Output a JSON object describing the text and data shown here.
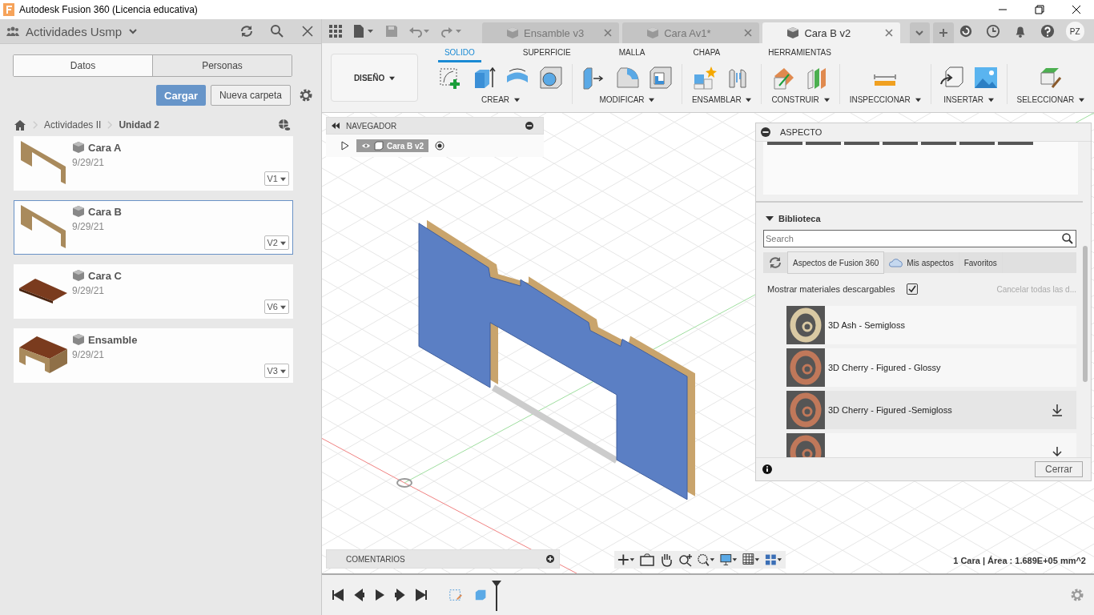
{
  "window": {
    "title": "Autodesk Fusion 360 (Licencia educativa)"
  },
  "data_panel": {
    "team": "Actividades Usmp",
    "tabs": [
      {
        "label": "Datos",
        "selected": true
      },
      {
        "label": "Personas",
        "selected": false
      }
    ],
    "buttons": [
      {
        "label": "Cargar",
        "kind": "primary"
      },
      {
        "label": "Nueva carpeta",
        "kind": "secondary"
      }
    ],
    "breadcrumb": [
      "Actividades II",
      "Unidad 2"
    ],
    "files": [
      {
        "name": "Cara A",
        "date": "9/29/21",
        "version": "V1",
        "kind": "wall",
        "selected": false
      },
      {
        "name": "Cara B",
        "date": "9/29/21",
        "version": "V2",
        "kind": "wall",
        "selected": true
      },
      {
        "name": "Cara C",
        "date": "9/29/21",
        "version": "V6",
        "kind": "board",
        "selected": false
      },
      {
        "name": "Ensamble",
        "date": "9/29/21",
        "version": "V3",
        "kind": "table",
        "selected": false
      }
    ]
  },
  "document_tabs": [
    {
      "label": "Ensamble v3",
      "selected": false
    },
    {
      "label": "Cara Av1*",
      "selected": false
    },
    {
      "label": "Cara B v2",
      "selected": true
    }
  ],
  "user": {
    "initials": "PZ"
  },
  "toolbar": {
    "workspace": "DISEÑO",
    "tabs": [
      {
        "label": "SOLIDO",
        "selected": true
      },
      {
        "label": "SUPERFICIE",
        "selected": false
      },
      {
        "label": "MALLA",
        "selected": false
      },
      {
        "label": "CHAPA",
        "selected": false
      },
      {
        "label": "HERRAMIENTAS",
        "selected": false
      }
    ],
    "groups": [
      {
        "label": "CREAR",
        "tools": [
          {
            "kind": "sketch"
          },
          {
            "kind": "extrude"
          },
          {
            "kind": "revolve"
          },
          {
            "kind": "hole"
          }
        ]
      },
      {
        "label": "MODIFICAR",
        "tools": [
          {
            "kind": "presspull"
          },
          {
            "kind": "fillet"
          },
          {
            "kind": "shell"
          }
        ]
      },
      {
        "label": "ENSAMBLAR",
        "tools": [
          {
            "kind": "component"
          },
          {
            "kind": "joint"
          }
        ]
      },
      {
        "label": "CONSTRUIR",
        "tools": [
          {
            "kind": "plane"
          },
          {
            "kind": "midplane"
          }
        ]
      },
      {
        "label": "INSPECCIONAR",
        "tools": [
          {
            "kind": "measure"
          }
        ]
      },
      {
        "label": "INSERTAR",
        "tools": [
          {
            "kind": "insert"
          },
          {
            "kind": "image"
          }
        ]
      },
      {
        "label": "SELECCIONAR",
        "tools": [
          {
            "kind": "select"
          }
        ]
      }
    ]
  },
  "browser": {
    "title": "NAVEGADOR",
    "root": "Cara B v2"
  },
  "comments": {
    "title": "COMENTARIOS"
  },
  "status": "1 Cara | Área : 1.689E+05 mm^2",
  "appearance": {
    "title": "ASPECTO",
    "library_title": "Biblioteca",
    "search": {
      "placeholder": "Search"
    },
    "tabs": [
      {
        "label": "Aspectos de Fusion 360",
        "selected": true
      },
      {
        "label": "Mis aspectos",
        "selected": false
      },
      {
        "label": "Favoritos",
        "selected": false
      }
    ],
    "show_downloadable": {
      "label": "Mostrar materiales descargables",
      "checked": true
    },
    "cancel_link": "Cancelar todas las d...",
    "materials": [
      {
        "name": "3D Ash - Semigloss",
        "color": "#d9c9a3",
        "downloadable": false,
        "selected": false
      },
      {
        "name": "3D Cherry - Figured - Glossy",
        "color": "#c0785a",
        "downloadable": false,
        "selected": false
      },
      {
        "name": "3D Cherry - Figured -Semigloss",
        "color": "#c0785a",
        "downloadable": true,
        "selected": true
      },
      {
        "color": "#c0785a",
        "downloadable": true,
        "selected": false
      }
    ],
    "close_button": "Cerrar"
  }
}
